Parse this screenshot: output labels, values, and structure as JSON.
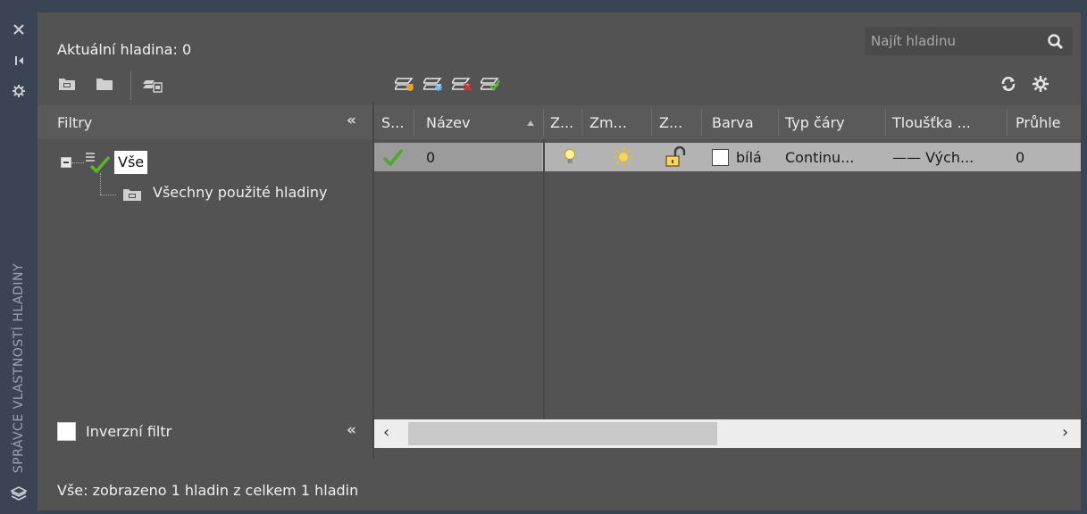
{
  "palette": {
    "window_bg": "#3b4453",
    "panel_bg": "#535353",
    "header_bg": "#5a5a5a",
    "row_selected": "#b3b3b3",
    "check_green": "#5ab52e"
  },
  "side_strip": {
    "icons": [
      "close-icon",
      "pin-icon",
      "settings-icon",
      "layers-icon"
    ],
    "vertical_title": "SPRÁVCE VLASTNOSTÍ HLADINY"
  },
  "header": {
    "current_layer": "Aktuální hladina: 0",
    "search_placeholder": "Najít hladinu"
  },
  "filters": {
    "title": "Filtry",
    "collapse_glyph": "«",
    "tree": {
      "root_label": "Vše",
      "child_label": "Všechny použité hladiny"
    },
    "invert_label": "Inverzní filtr",
    "invert_checked": false
  },
  "grid": {
    "columns": [
      "S...",
      "Název",
      "Z...",
      "Zm...",
      "Z...",
      "Barva",
      "Typ čáry",
      "Tloušťka ...",
      "Průhle"
    ],
    "row": {
      "name": "0",
      "color_name": "bílá",
      "linetype": "Continu...",
      "lineweight": "—— Vých...",
      "transparency": "0"
    }
  },
  "status": "Vše: zobrazeno 1 hladin z celkem 1 hladin"
}
